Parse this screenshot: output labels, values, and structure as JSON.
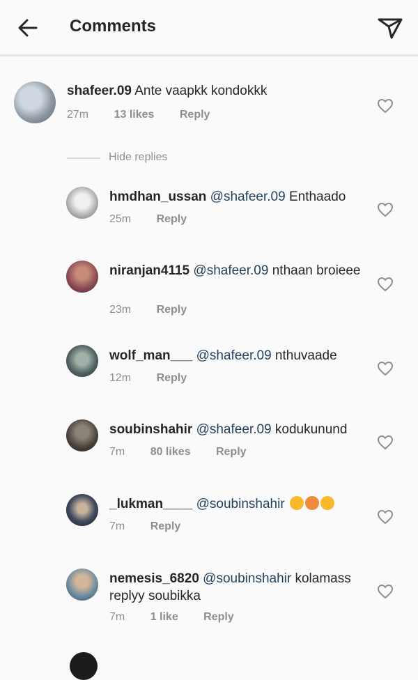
{
  "header": {
    "title": "Comments",
    "back_icon": "back-arrow-icon",
    "send_icon": "direct-send-icon"
  },
  "main_comment": {
    "username": "shafeer.09",
    "text": "Ante vaapkk kondokkk",
    "time": "27m",
    "likes": "13 likes",
    "reply": "Reply"
  },
  "hide_replies": "Hide replies",
  "replies": [
    {
      "username": "hmdhan_ussan",
      "mention": "@shafeer.09",
      "text": "Enthaado",
      "time": "25m",
      "likes": "",
      "reply": "Reply"
    },
    {
      "username": "niranjan4115",
      "mention": "@shafeer.09",
      "text": "nthaan broieee",
      "time": "23m",
      "likes": "",
      "reply": "Reply"
    },
    {
      "username": "wolf_man___",
      "mention": "@shafeer.09",
      "text": "nthuvaade",
      "time": "12m",
      "likes": "",
      "reply": "Reply"
    },
    {
      "username": "soubinshahir",
      "mention": "@shafeer.09",
      "text": "kodukunund",
      "time": "7m",
      "likes": "80 likes",
      "reply": "Reply"
    },
    {
      "username": "_lukman____",
      "mention": "@soubinshahir",
      "text": "",
      "time": "7m",
      "likes": "",
      "reply": "Reply"
    },
    {
      "username": "nemesis_6820",
      "mention": "@soubinshahir",
      "text": "kolamass replyy soubikka",
      "time": "7m",
      "likes": "1 like",
      "reply": "Reply"
    }
  ],
  "colors": {
    "mention": "#1f3f5c",
    "meta": "#8e8e8e",
    "text": "#262626",
    "background": "#fafafa"
  }
}
